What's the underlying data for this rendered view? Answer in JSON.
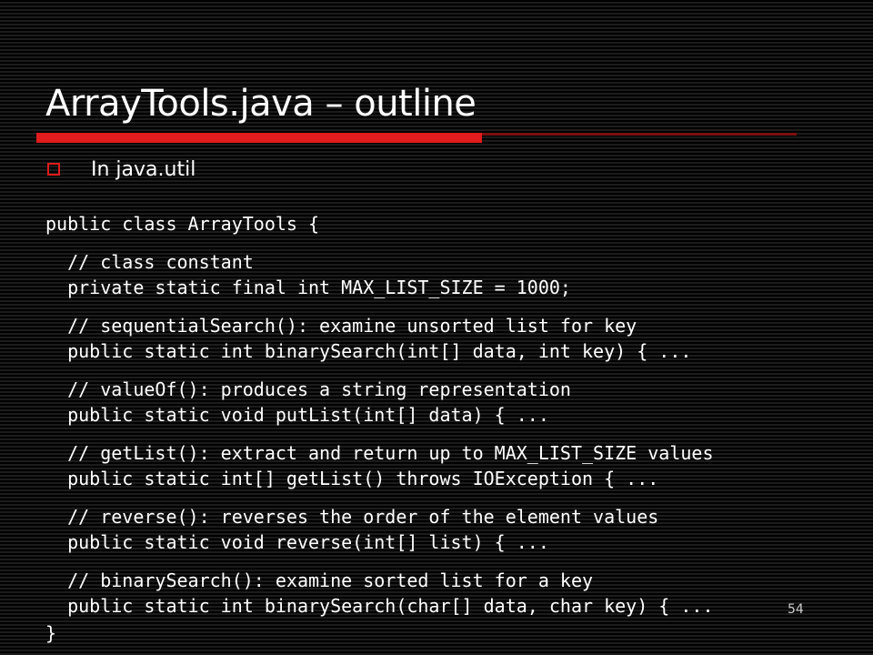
{
  "slide": {
    "title": "ArrayTools.java – outline",
    "bullet": "In java.util",
    "slide_number": "54"
  },
  "code": {
    "lines": [
      "public class ArrayTools {",
      "  // class constant",
      "  private static final int MAX_LIST_SIZE = 1000;",
      "  // sequentialSearch(): examine unsorted list for key",
      "  public static int binarySearch(int[] data, int key) { ...",
      "  // valueOf(): produces a string representation",
      "  public static void putList(int[] data) { ...",
      "  // getList(): extract and return up to MAX_LIST_SIZE values",
      "  public static int[] getList() throws IOException { ...",
      "  // reverse(): reverses the order of the element values",
      "  public static void reverse(int[] list) { ...",
      "  // binarySearch(): examine sorted list for a key",
      "  public static int binarySearch(char[] data, char key) { ...",
      "}"
    ]
  },
  "colors": {
    "accent": "#e01c1c",
    "background": "#000000",
    "text": "#ffffff"
  }
}
